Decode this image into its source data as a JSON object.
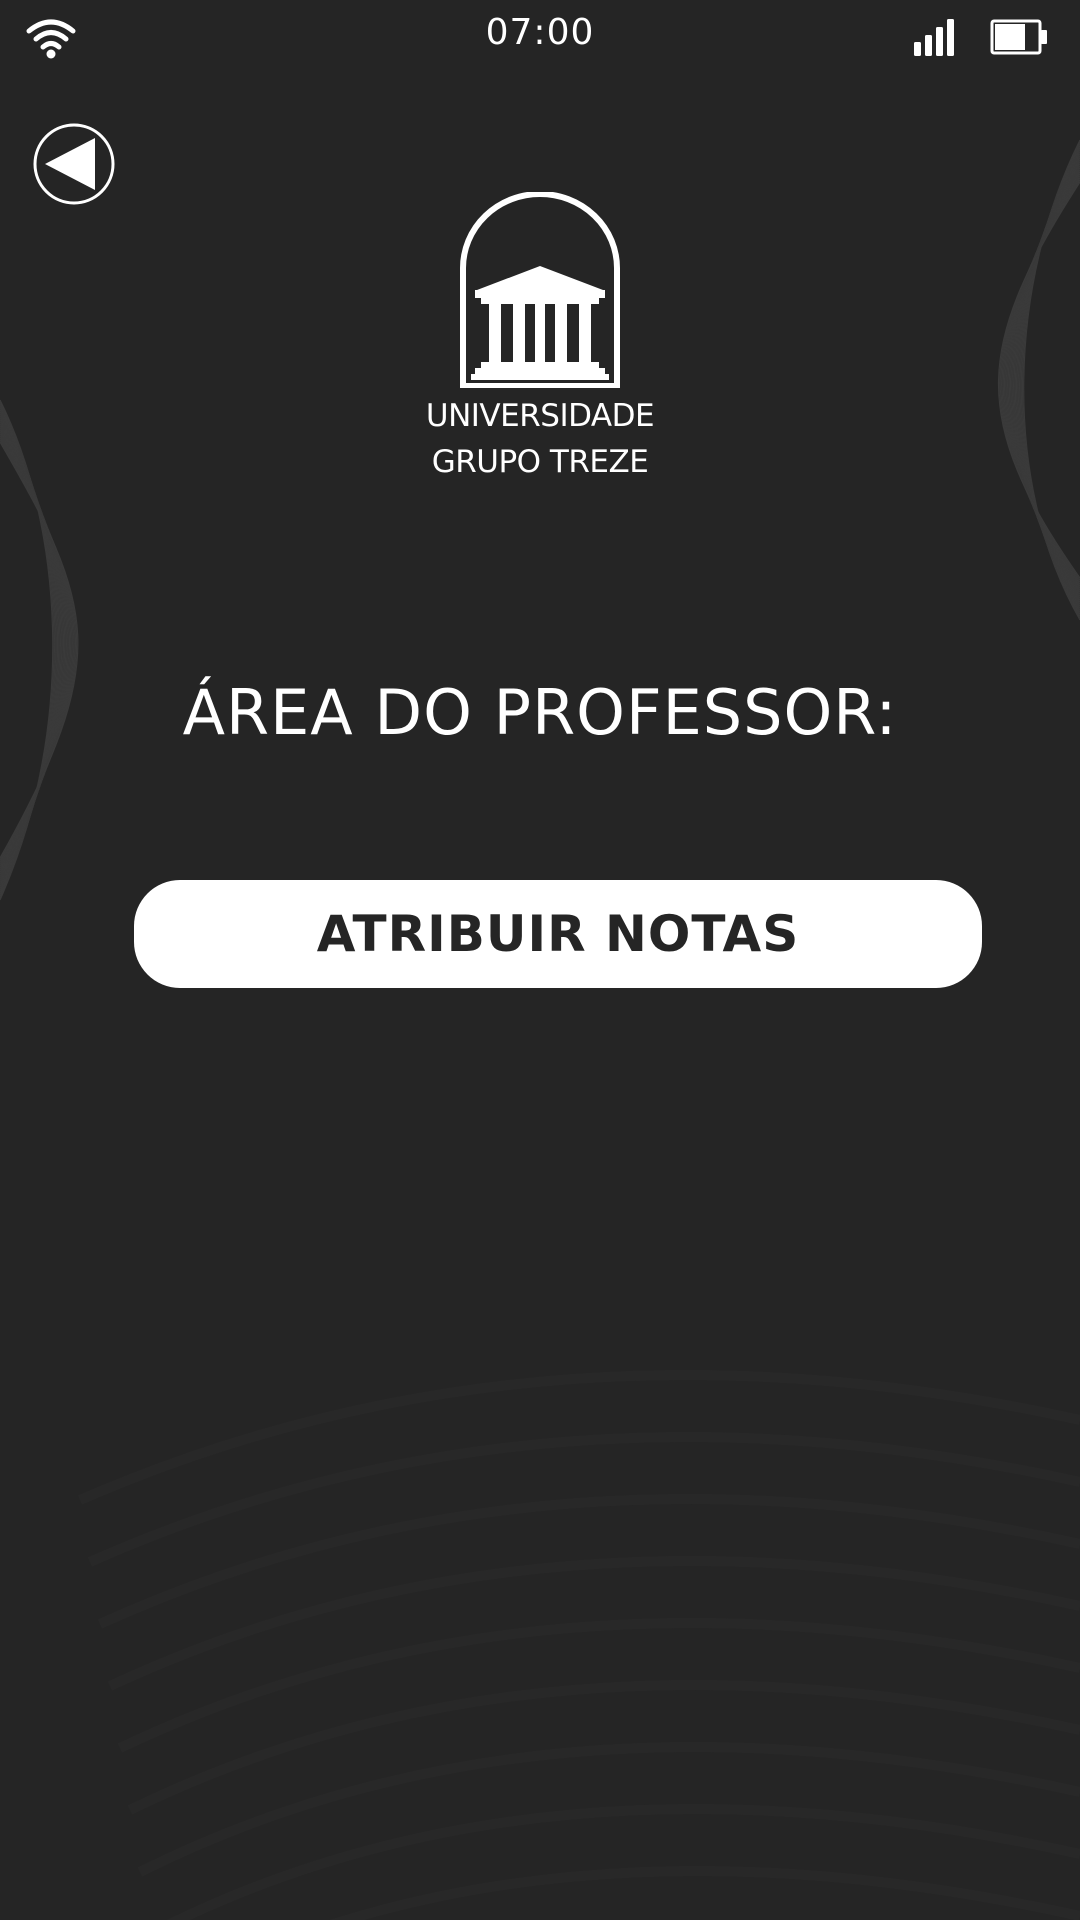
{
  "status_bar": {
    "time": "07:00",
    "icons": [
      "wifi-icon",
      "signal-icon",
      "battery-icon"
    ]
  },
  "navigation": {
    "back_icon": "back-arrow-icon"
  },
  "logo": {
    "icon": "university-building-icon",
    "line1": "UNIVERSIDADE",
    "line2": "GRUPO TREZE"
  },
  "main": {
    "title": "ÁREA DO PROFESSOR:",
    "actions": [
      {
        "label": "ATRIBUIR NOTAS"
      }
    ]
  },
  "colors": {
    "background": "#252525",
    "foreground": "#ffffff",
    "button_background": "#ffffff",
    "button_text": "#252525"
  }
}
